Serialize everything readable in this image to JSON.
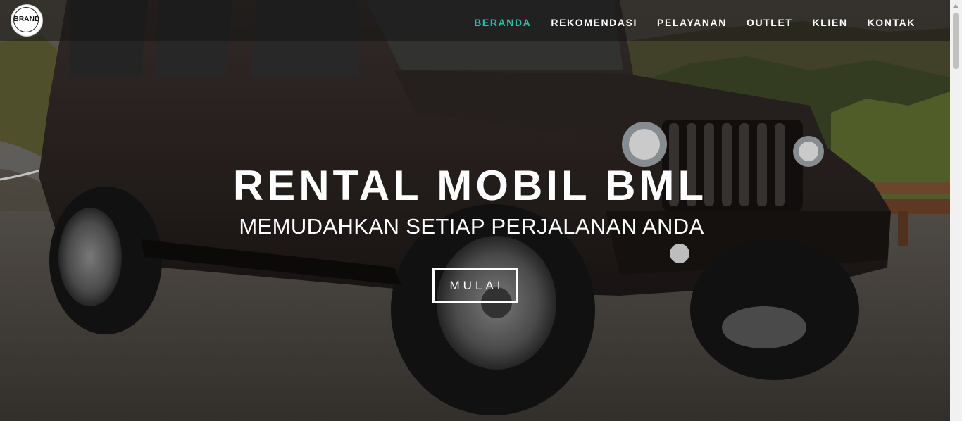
{
  "brand": {
    "logo_text": "BRAND"
  },
  "nav": {
    "items": [
      {
        "label": "BERANDA",
        "active": true
      },
      {
        "label": "REKOMENDASI"
      },
      {
        "label": "PELAYANAN"
      },
      {
        "label": "OUTLET"
      },
      {
        "label": "KLIEN"
      },
      {
        "label": "KONTAK"
      }
    ]
  },
  "hero": {
    "title": "RENTAL MOBIL BML",
    "subtitle": "MEMUDAHKAN SETIAP PERJALANAN ANDA",
    "cta_label": "MULAI"
  },
  "colors": {
    "accent": "#2bc0a8",
    "nav_text": "#ffffff"
  }
}
